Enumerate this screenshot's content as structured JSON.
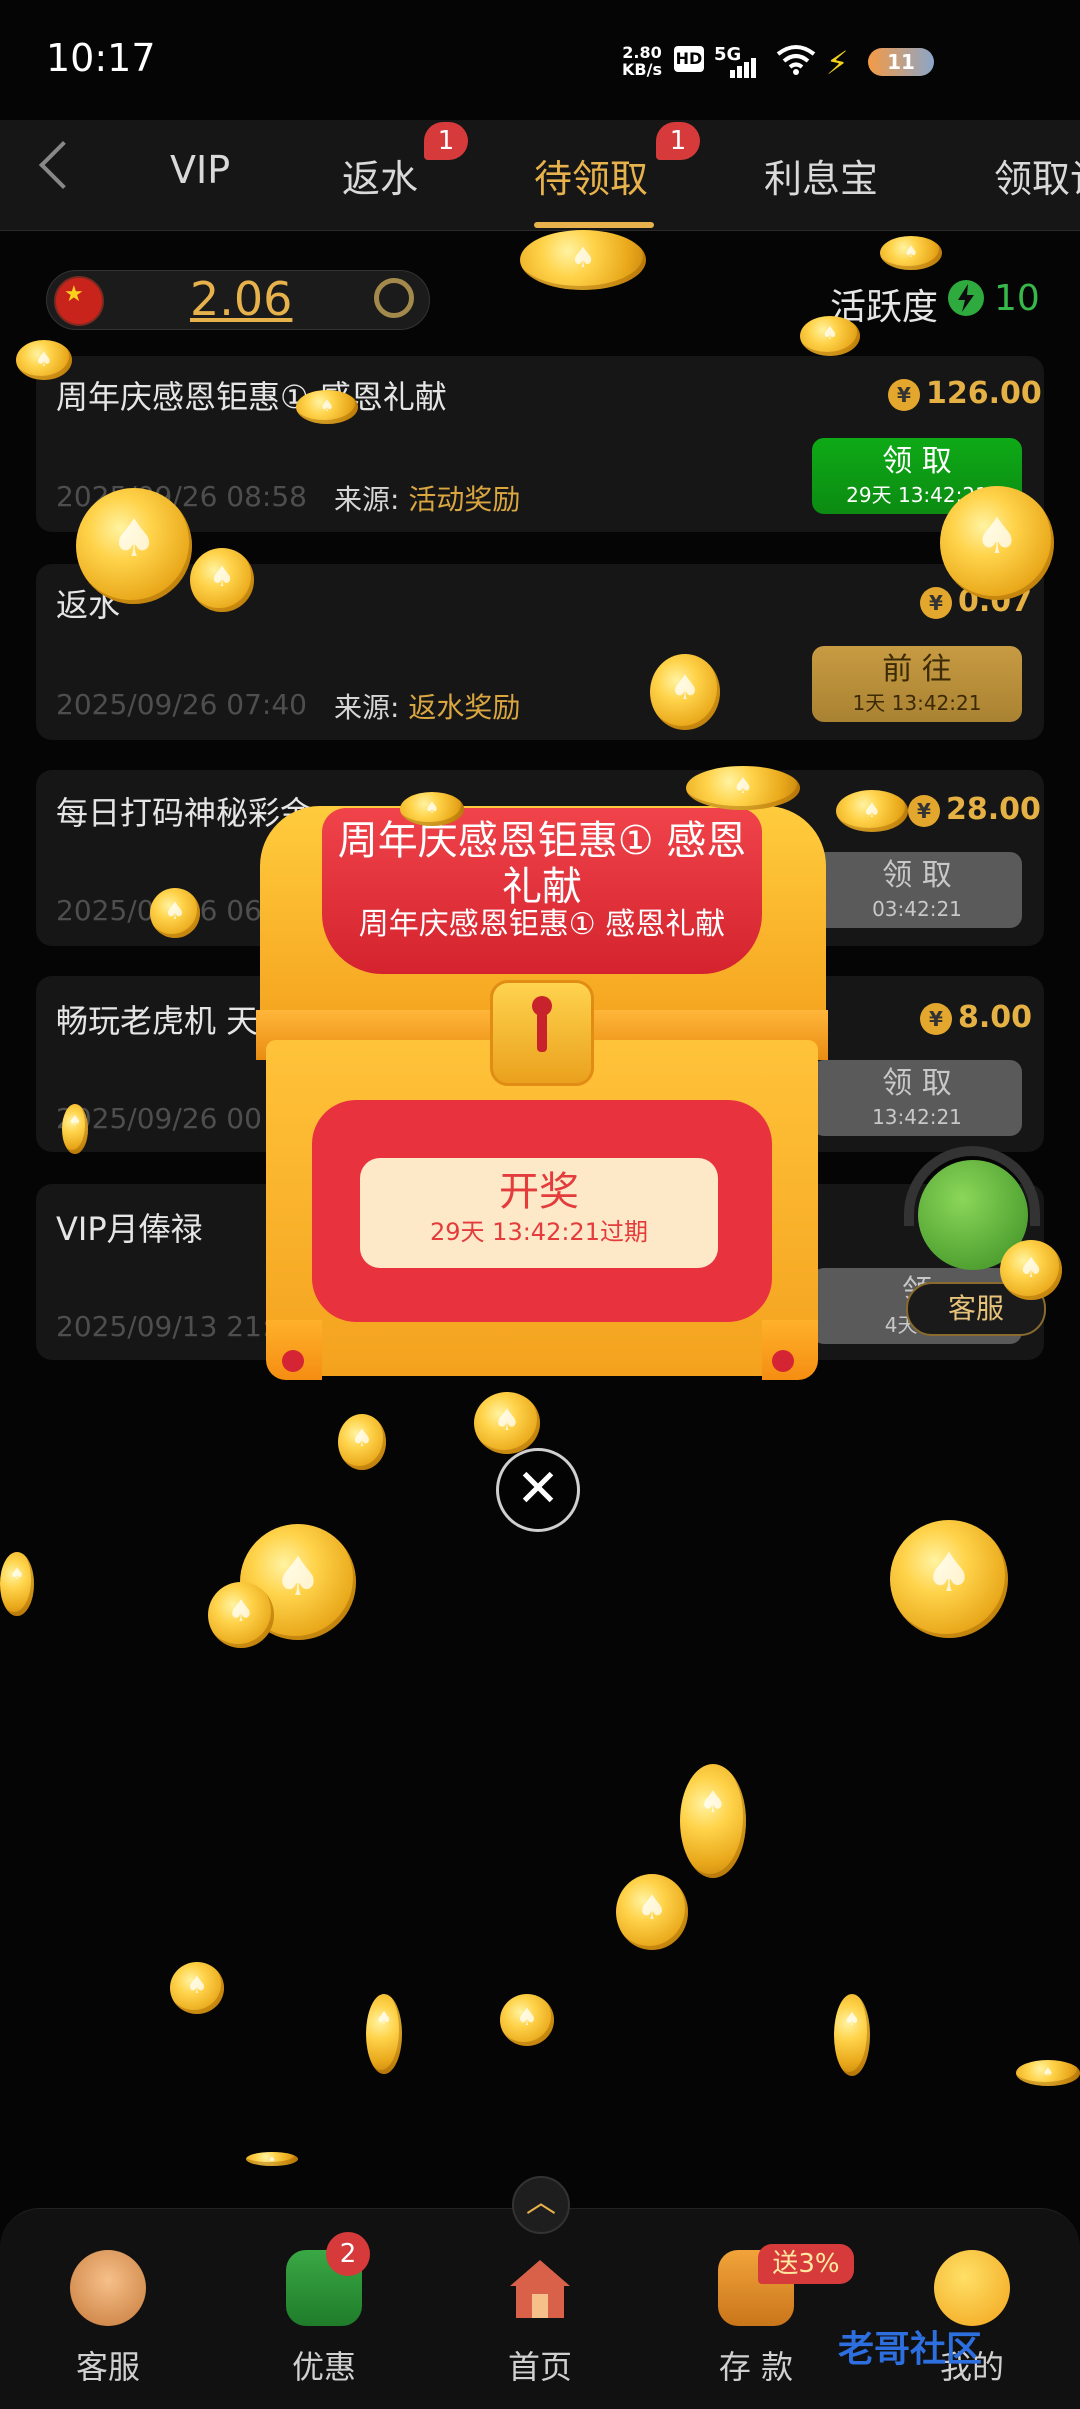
{
  "status_bar": {
    "time": "10:17",
    "net_speed_value": "2.80",
    "net_speed_unit": "KB/s",
    "hd": "HD",
    "network": "5G",
    "battery": "11"
  },
  "tabs": [
    {
      "label": "VIP"
    },
    {
      "label": "返水",
      "badge": "1"
    },
    {
      "label": "待领取",
      "badge": "1",
      "active": true
    },
    {
      "label": "利息宝"
    },
    {
      "label": "领取记"
    }
  ],
  "balance": {
    "value": "2.06"
  },
  "activity": {
    "label": "活跃度",
    "value": "10"
  },
  "records": [
    {
      "title": "周年庆感恩钜惠① 感恩礼献",
      "amount": "126.00",
      "date": "2025/09/26 08:58",
      "source_label": "来源:",
      "source": "活动奖励",
      "button": "领 取",
      "button_sub": "29天 13:42:21",
      "style": "green"
    },
    {
      "title": "返水",
      "amount": "0.07",
      "date": "2025/09/26 07:40",
      "source_label": "来源:",
      "source": "返水奖励",
      "button": "前 往",
      "button_sub": "1天 13:42:21",
      "style": "gold"
    },
    {
      "title": "每日打码神秘彩金",
      "amount": "28.00",
      "date": "2025/09/26 06",
      "source_label": "",
      "source": "",
      "button": "领 取",
      "button_sub": "03:42:21",
      "style": "grey"
    },
    {
      "title": "畅玩老虎机 天",
      "amount": "8.00",
      "date": "2025/09/26 00",
      "source_label": "",
      "source": "",
      "button": "领 取",
      "button_sub": "13:42:21",
      "style": "grey"
    },
    {
      "title": "VIP月俸禄",
      "amount": "",
      "date": "2025/09/13 21:2",
      "source_label": "",
      "source": "",
      "button": "领",
      "button_sub": "4天 13",
      "style": "grey"
    }
  ],
  "modal": {
    "title": "周年庆感恩钜惠① 感恩礼献",
    "subtitle": "周年庆感恩钜惠① 感恩礼献",
    "open_label": "开奖",
    "expire": "29天 13:42:21过期",
    "close_symbol": "✕"
  },
  "float_service": {
    "label": "客服"
  },
  "bottom_nav": [
    {
      "label": "客服"
    },
    {
      "label": "优惠",
      "badge": "2"
    },
    {
      "label": "首页"
    },
    {
      "label": "存 款",
      "badge": "送3%"
    },
    {
      "label": "我的"
    }
  ],
  "watermark": "老哥社区"
}
